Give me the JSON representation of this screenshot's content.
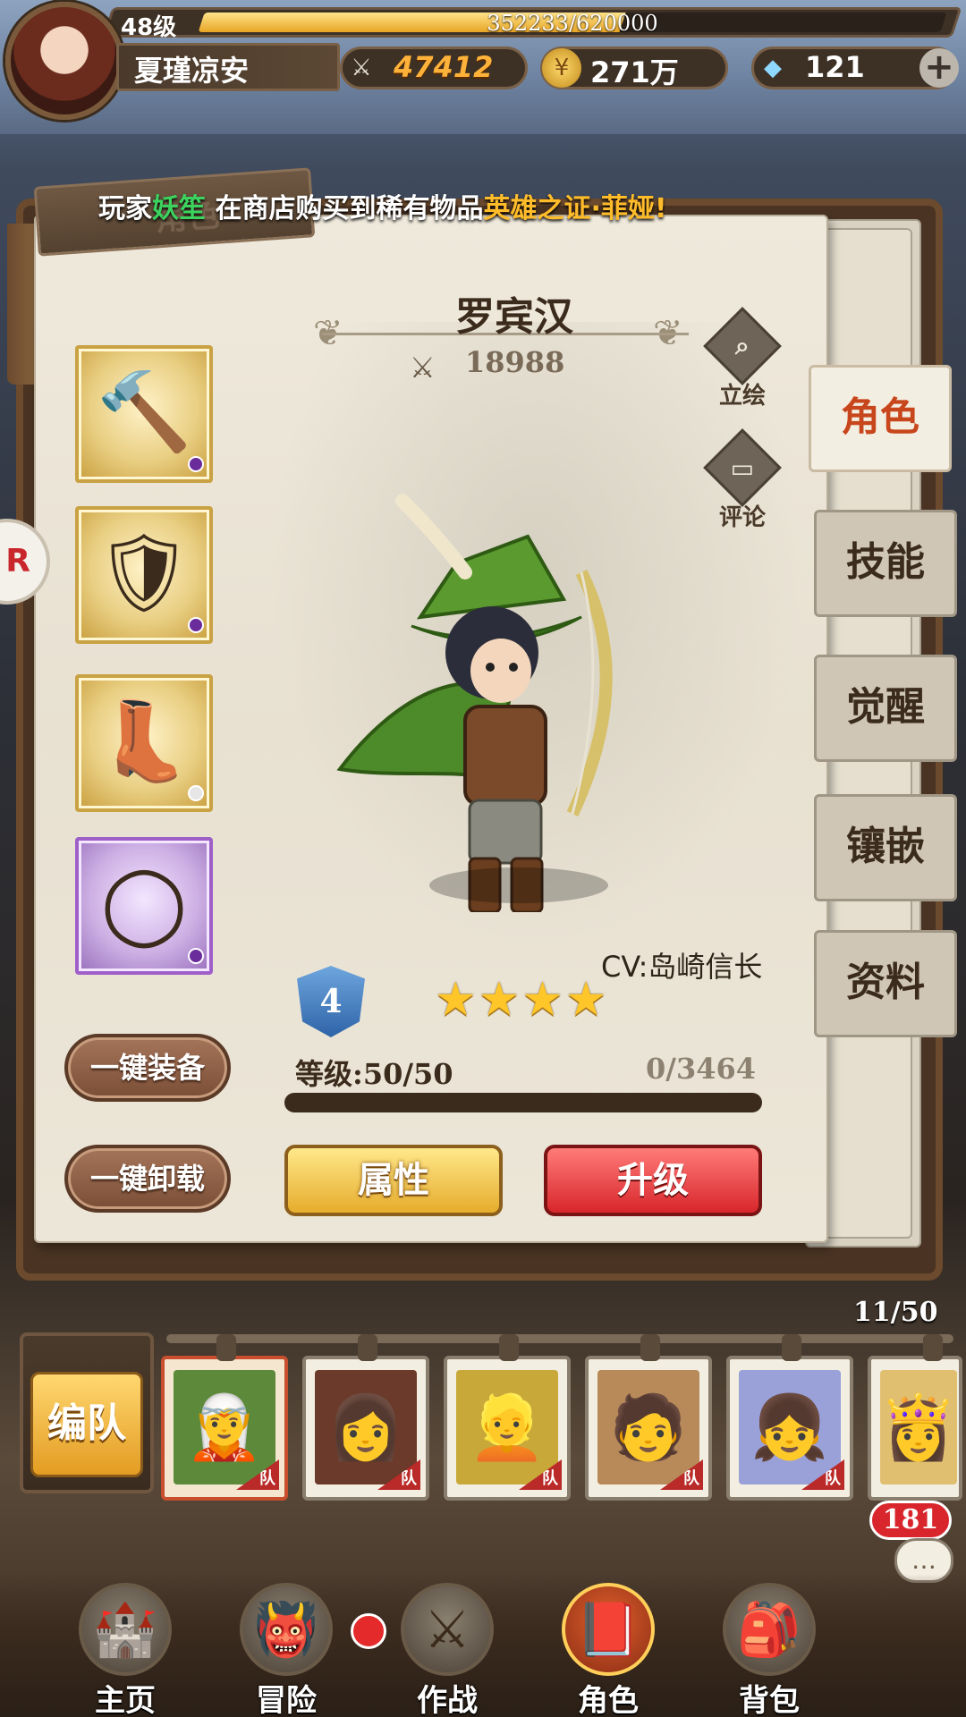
{
  "player": {
    "level": "48级",
    "exp": "352233/620000",
    "exp_fraction": 0.568,
    "name": "夏瑾凉安",
    "power": "47412",
    "gold": "271万",
    "gems": "121"
  },
  "ticker": {
    "prefix": "玩家",
    "player": "妖笙",
    "middle": " 在商店购买到稀有物品",
    "item": "英雄之证·菲娅!"
  },
  "book": {
    "tab_label": "角色",
    "hero_name": "罗宾汉",
    "hero_power": "18988",
    "portrait_label": "立绘",
    "comment_label": "评论",
    "cv": "CV:岛崎信长",
    "rank": "4",
    "stars": 4,
    "level_label": "等级:50/50",
    "level_exp": "0/3464",
    "buttons": {
      "equip_all": "一键装备",
      "unequip_all": "一键卸载",
      "attributes": "属性",
      "upgrade": "升级"
    }
  },
  "right_tabs": [
    "角色",
    "技能",
    "觉醒",
    "镶嵌",
    "资料"
  ],
  "equipment": [
    {
      "icon": "hammer-icon",
      "glyph": "🔨",
      "rarity": "gold",
      "dot": "purple"
    },
    {
      "icon": "armor-icon",
      "glyph": "🛡",
      "rarity": "gold",
      "dot": "purple"
    },
    {
      "icon": "boots-icon",
      "glyph": "👢",
      "rarity": "gold",
      "dot": "white"
    },
    {
      "icon": "ring-icon",
      "glyph": "◯",
      "rarity": "purple",
      "dot": "purple"
    }
  ],
  "team": {
    "button": "编队",
    "count": "11/50",
    "tag": "队",
    "cards": [
      "🧝",
      "👩",
      "👱",
      "🧑",
      "👧",
      "👸"
    ]
  },
  "chat_badge": "181",
  "nav": [
    {
      "label": "主页",
      "icon": "castle-icon",
      "glyph": "🏰"
    },
    {
      "label": "冒险",
      "icon": "monster-icon",
      "glyph": "👹"
    },
    {
      "label": "作战",
      "icon": "battle-icon",
      "glyph": "⚔"
    },
    {
      "label": "角色",
      "icon": "book-icon",
      "glyph": "📕"
    },
    {
      "label": "背包",
      "icon": "bag-icon",
      "glyph": "🎒"
    }
  ],
  "colors": {
    "accent_gold": "#e6ac2c",
    "upgrade_red": "#d8262c",
    "active_tab": "#c8461b"
  }
}
